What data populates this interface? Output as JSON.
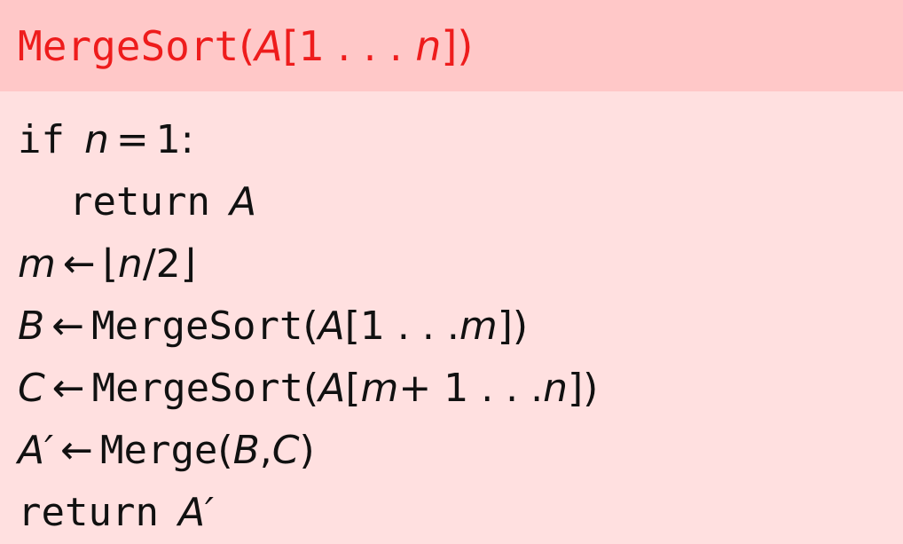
{
  "title": {
    "fn": "MergeSort",
    "open": "(",
    "arr": "A",
    "bracket_open": "[1 . . . ",
    "var": "n",
    "close": "])"
  },
  "lines": [
    {
      "kw": "if",
      "v1": "n",
      "op": "=",
      "rest": "1:"
    },
    {
      "kw": "return",
      "v1": "A"
    },
    {
      "v1": "m",
      "op": "←",
      "rest_open": "⌊",
      "v2": "n",
      "rest_close": "/2⌋"
    },
    {
      "v1": "B",
      "op": "←",
      "fn": "MergeSort",
      "p1": "(",
      "v2": "A",
      "p2": "[1 . . . ",
      "v3": "m",
      "p3": "])"
    },
    {
      "v1": "C",
      "op": "←",
      "fn": "MergeSort",
      "p1": "(",
      "v2": "A",
      "p2": "[",
      "v3": "m",
      "p3": " + 1 . . . ",
      "v4": "n",
      "p4": "])"
    },
    {
      "v1": "A′",
      "op": "←",
      "fn": "Merge",
      "p1": "(",
      "v2": "B",
      "p2": ", ",
      "v3": "C",
      "p3": ")"
    },
    {
      "kw": "return",
      "v1": "A′"
    }
  ],
  "colors": {
    "title": "#ee1c1c",
    "header_bg": "#ffc8c8",
    "body_bg": "#ffe0e0",
    "text": "#111111"
  }
}
